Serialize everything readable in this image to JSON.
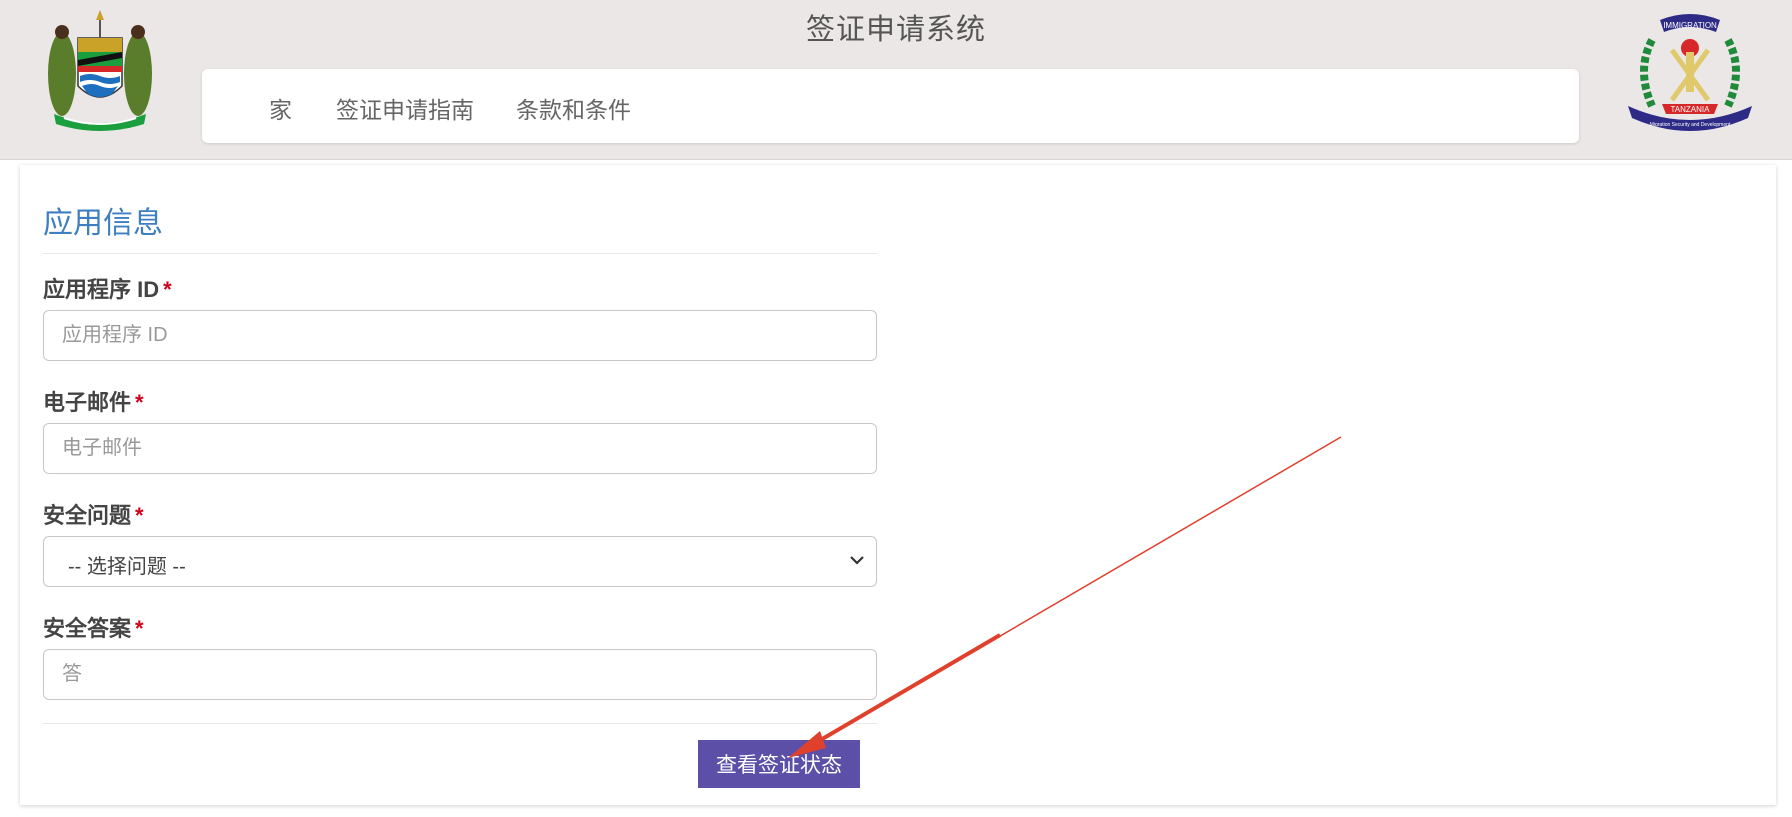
{
  "header": {
    "title": "签证申请系统",
    "nav": [
      "家",
      "签证申请指南",
      "条款和条件"
    ],
    "right_emblem_top_text": "IMMIGRATION",
    "right_emblem_banner_text": "TANZANIA",
    "right_emblem_bottom_text": "Migration Security and Development"
  },
  "form": {
    "section_title": "应用信息",
    "app_id_label": "应用程序 ID",
    "app_id_placeholder": "应用程序 ID",
    "email_label": "电子邮件",
    "email_placeholder": "电子邮件",
    "question_label": "安全问题",
    "question_selected": "-- 选择问题 --",
    "answer_label": "安全答案",
    "answer_placeholder": "答",
    "required_mark": "*",
    "submit_label": "查看签证状态"
  },
  "colors": {
    "header_bg": "#ebe7e6",
    "section_title": "#3d7fc0",
    "button_bg": "#5b4fa8",
    "required": "#d0021b",
    "annotation_arrow": "#e0412c"
  }
}
